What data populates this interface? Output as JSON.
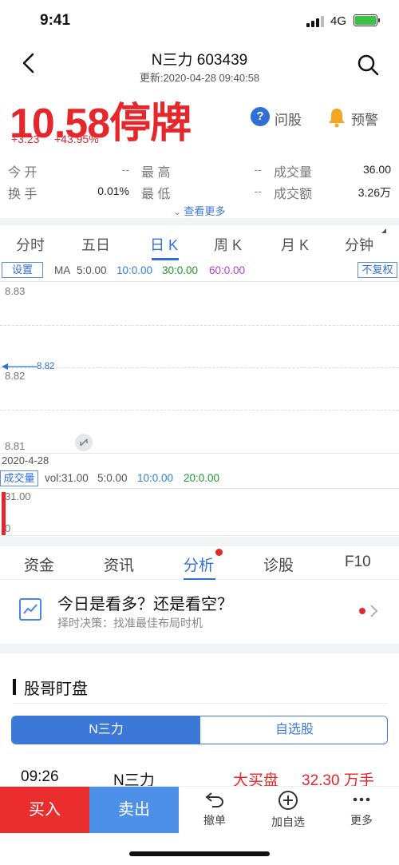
{
  "status": {
    "time": "9:41",
    "network": "4G"
  },
  "nav": {
    "title": "N三力 603439",
    "updated": "更新:2020-04-28 09:40:58"
  },
  "quote": {
    "price": "10.58停牌",
    "change": "+3.23",
    "change_pct": "+43.95%",
    "ask_label": "问股",
    "alert_label": "预警"
  },
  "stats": [
    {
      "label": "今 开",
      "value": "--"
    },
    {
      "label": "最 高",
      "value": "--"
    },
    {
      "label": "成交量",
      "value": "36.00"
    },
    {
      "label": "换 手",
      "value": "0.01%"
    },
    {
      "label": "最 低",
      "value": "--"
    },
    {
      "label": "成交额",
      "value": "3.26万"
    }
  ],
  "more_label": "查看更多",
  "periods": [
    "分时",
    "五日",
    "日 K",
    "周 K",
    "月 K",
    "分钟"
  ],
  "active_period": "日 K",
  "ma": {
    "settings_label": "设置",
    "ma_label": "MA",
    "ma5": "5:0.00",
    "ma10": "10:0.00",
    "ma30": "30:0.00",
    "ma60": "60:0.00",
    "adjust_label": "不复权"
  },
  "chart_data": {
    "type": "line",
    "y_ticks": [
      "8.83",
      "8.82",
      "8.81"
    ],
    "marker_value": "8.82",
    "x_label": "2020-4-28",
    "ylim": [
      8.81,
      8.83
    ]
  },
  "volume": {
    "label": "成交量",
    "vol": "vol:31.00",
    "ma5": "5:0.00",
    "ma10": "10:0.00",
    "ma20": "20:0.00",
    "top_tick": "31.00",
    "bottom_tick": "0",
    "value": 31.0
  },
  "info_tabs": [
    "资金",
    "资讯",
    "分析",
    "诊股",
    "F10"
  ],
  "active_info_tab": "分析",
  "card": {
    "title": "今日是看多？还是看空？",
    "subtitle": "择时决策：找准最佳布局时机"
  },
  "section": {
    "title": "股哥盯盘"
  },
  "segment": {
    "left": "N三力",
    "right": "自选股"
  },
  "alert_row": {
    "time": "09:26",
    "name": "N三力",
    "kind": "大买盘",
    "amount": "32.30 万手"
  },
  "bottom_bar": {
    "buy": "买入",
    "sell": "卖出",
    "cancel": "撤单",
    "add_watch": "加自选",
    "more": "更多"
  },
  "colors": {
    "red": "#e5262b",
    "blue": "#2f6fd6",
    "ma10": "#2f7fd8",
    "ma30": "#1a9a2a",
    "ma60": "#b53fd1"
  }
}
